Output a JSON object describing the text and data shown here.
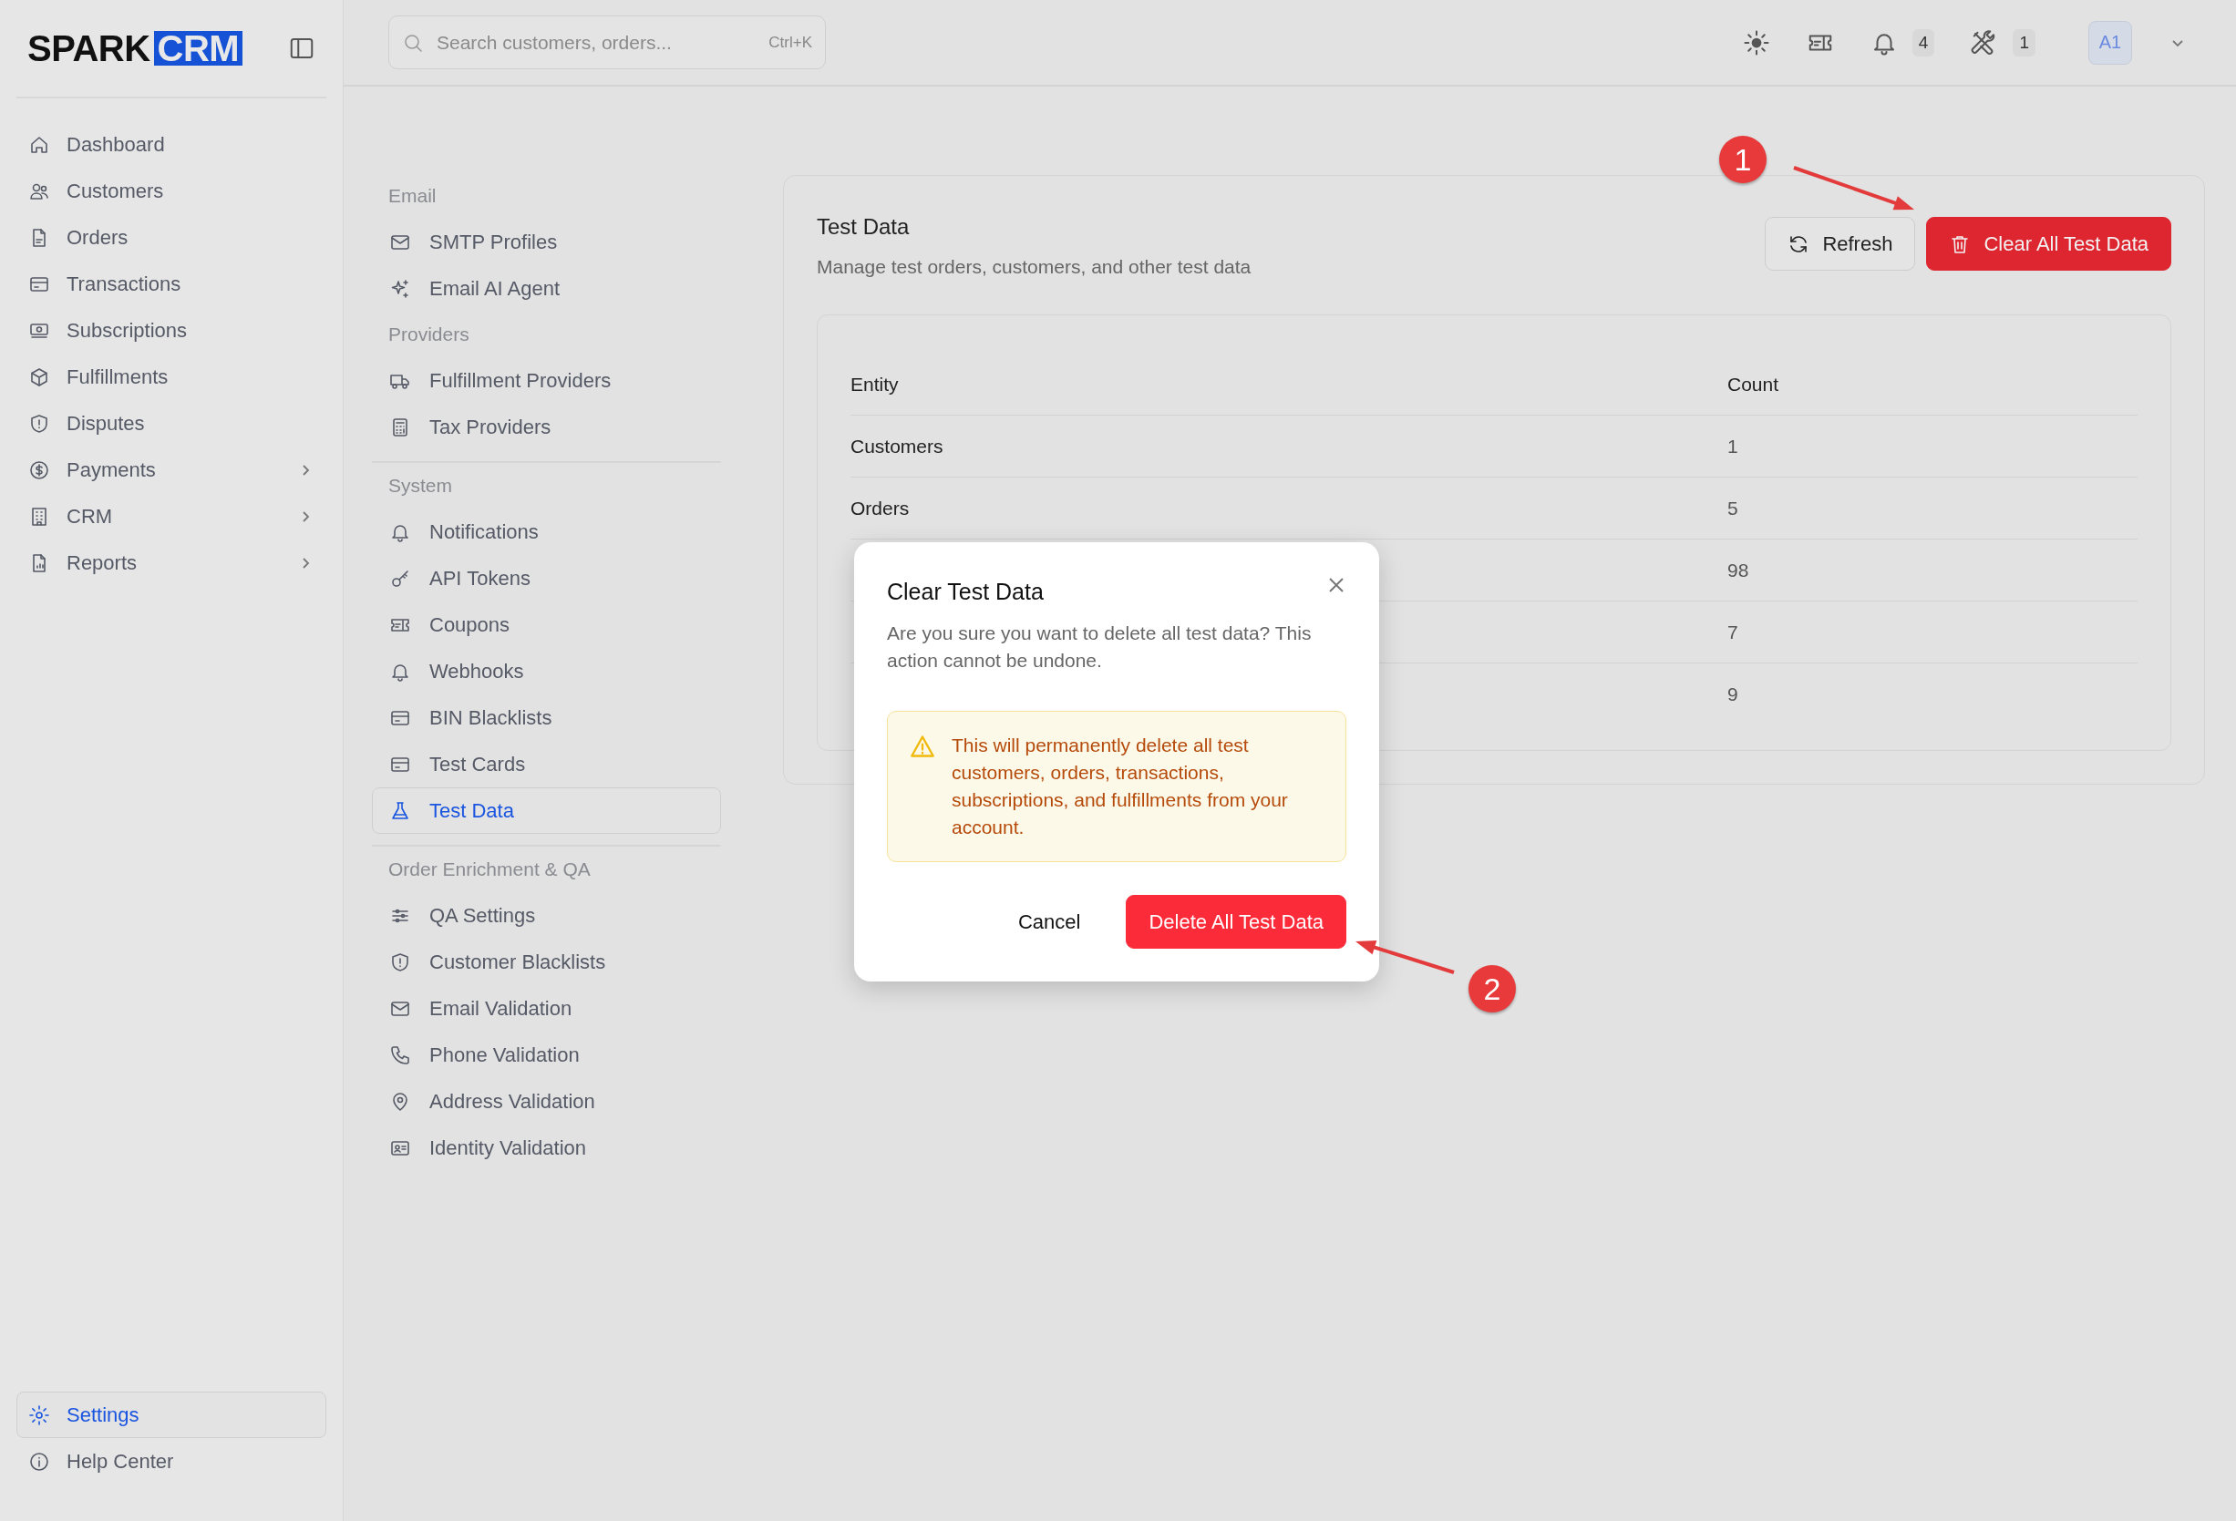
{
  "brand": {
    "name": "SPARK",
    "tag": "CRM"
  },
  "sidebar": {
    "items": [
      {
        "label": "Dashboard",
        "selected": false,
        "expandable": false
      },
      {
        "label": "Customers",
        "selected": false,
        "expandable": false
      },
      {
        "label": "Orders",
        "selected": false,
        "expandable": false
      },
      {
        "label": "Transactions",
        "selected": false,
        "expandable": false
      },
      {
        "label": "Subscriptions",
        "selected": false,
        "expandable": false
      },
      {
        "label": "Fulfillments",
        "selected": false,
        "expandable": false
      },
      {
        "label": "Disputes",
        "selected": false,
        "expandable": false
      },
      {
        "label": "Payments",
        "selected": false,
        "expandable": true
      },
      {
        "label": "CRM",
        "selected": false,
        "expandable": true
      },
      {
        "label": "Reports",
        "selected": false,
        "expandable": true
      }
    ],
    "footer_items": [
      {
        "label": "Settings",
        "selected": true
      },
      {
        "label": "Help Center",
        "selected": false
      }
    ]
  },
  "topbar": {
    "search": {
      "placeholder": "Search customers, orders...",
      "shortcut": "Ctrl+K"
    },
    "notifications_count": "4",
    "tools_count": "1",
    "avatar": "A1"
  },
  "settings_nav": {
    "sections": [
      {
        "heading": "Email",
        "divider_above": false,
        "items": [
          {
            "label": "SMTP Profiles",
            "selected": false
          },
          {
            "label": "Email AI Agent",
            "selected": false
          }
        ]
      },
      {
        "heading": "Providers",
        "divider_above": false,
        "items": [
          {
            "label": "Fulfillment Providers",
            "selected": false
          },
          {
            "label": "Tax Providers",
            "selected": false
          }
        ]
      },
      {
        "heading": "System",
        "divider_above": true,
        "items": [
          {
            "label": "Notifications",
            "selected": false
          },
          {
            "label": "API Tokens",
            "selected": false
          },
          {
            "label": "Coupons",
            "selected": false
          },
          {
            "label": "Webhooks",
            "selected": false
          },
          {
            "label": "BIN Blacklists",
            "selected": false
          },
          {
            "label": "Test Cards",
            "selected": false
          },
          {
            "label": "Test Data",
            "selected": true
          }
        ]
      },
      {
        "heading": "Order Enrichment & QA",
        "divider_above": true,
        "items": [
          {
            "label": "QA Settings",
            "selected": false
          },
          {
            "label": "Customer Blacklists",
            "selected": false
          },
          {
            "label": "Email Validation",
            "selected": false
          },
          {
            "label": "Phone Validation",
            "selected": false
          },
          {
            "label": "Address Validation",
            "selected": false
          },
          {
            "label": "Identity Validation",
            "selected": false
          }
        ]
      }
    ]
  },
  "test_data": {
    "title": "Test Data",
    "subtitle": "Manage test orders, customers, and other test data",
    "refresh_button": "Refresh",
    "clear_button": "Clear All Test Data",
    "table": {
      "columns": [
        "Entity",
        "Count"
      ],
      "rows": [
        {
          "entity": "Customers",
          "count": "1"
        },
        {
          "entity": "Orders",
          "count": "5"
        },
        {
          "count": "98"
        },
        {
          "count": "7"
        },
        {
          "count": "9"
        }
      ]
    }
  },
  "dialog": {
    "title": "Clear Test Data",
    "message": "Are you sure you want to delete all test data? This action cannot be undone.",
    "warning": "This will permanently delete all test customers, orders, transactions, subscriptions, and fulfillments from your account.",
    "cancel_button": "Cancel",
    "confirm_button": "Delete All Test Data"
  },
  "annotations": [
    {
      "label": "1"
    },
    {
      "label": "2"
    }
  ]
}
